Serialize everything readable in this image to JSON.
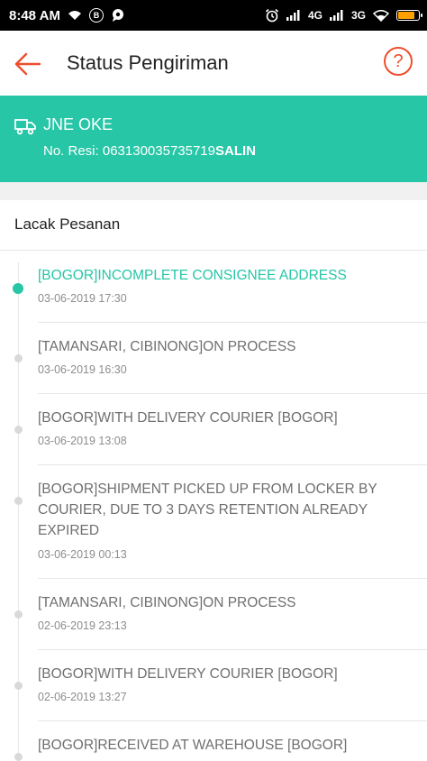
{
  "statusbar": {
    "time": "8:48 AM",
    "badge_b": "B",
    "net1": "4G",
    "net2": "3G",
    "battery_level": 0.9,
    "icons": [
      "wifi-icon",
      "b-badge-icon",
      "chat-icon",
      "alarm-icon",
      "signal-icon",
      "wifi-icon",
      "battery-icon"
    ]
  },
  "header": {
    "title": "Status Pengiriman",
    "help_label": "?"
  },
  "courier": {
    "name": "JNE OKE",
    "resi_label": "No. Resi: ",
    "resi_number": "063130035735719",
    "copy_label": "SALIN"
  },
  "tracking": {
    "title": "Lacak Pesanan",
    "events": [
      {
        "desc": "[BOGOR]INCOMPLETE CONSIGNEE ADDRESS",
        "time": "03-06-2019 17:30",
        "active": true
      },
      {
        "desc": "[TAMANSARI, CIBINONG]ON PROCESS",
        "time": "03-06-2019 16:30",
        "active": false
      },
      {
        "desc": "[BOGOR]WITH DELIVERY COURIER [BOGOR]",
        "time": "03-06-2019 13:08",
        "active": false
      },
      {
        "desc": "[BOGOR]SHIPMENT PICKED UP FROM LOCKER BY COURIER, DUE TO 3 DAYS RETENTION ALREADY EXPIRED",
        "time": "03-06-2019 00:13",
        "active": false
      },
      {
        "desc": "[TAMANSARI, CIBINONG]ON PROCESS",
        "time": "02-06-2019 23:13",
        "active": false
      },
      {
        "desc": "[BOGOR]WITH DELIVERY COURIER [BOGOR]",
        "time": "02-06-2019 13:27",
        "active": false
      },
      {
        "desc": "[BOGOR]RECEIVED AT WAREHOUSE [BOGOR]",
        "time": "",
        "active": false
      }
    ]
  },
  "colors": {
    "accent": "#26c6a6",
    "brand": "#ee4d2d",
    "battery": "#ffa000"
  }
}
